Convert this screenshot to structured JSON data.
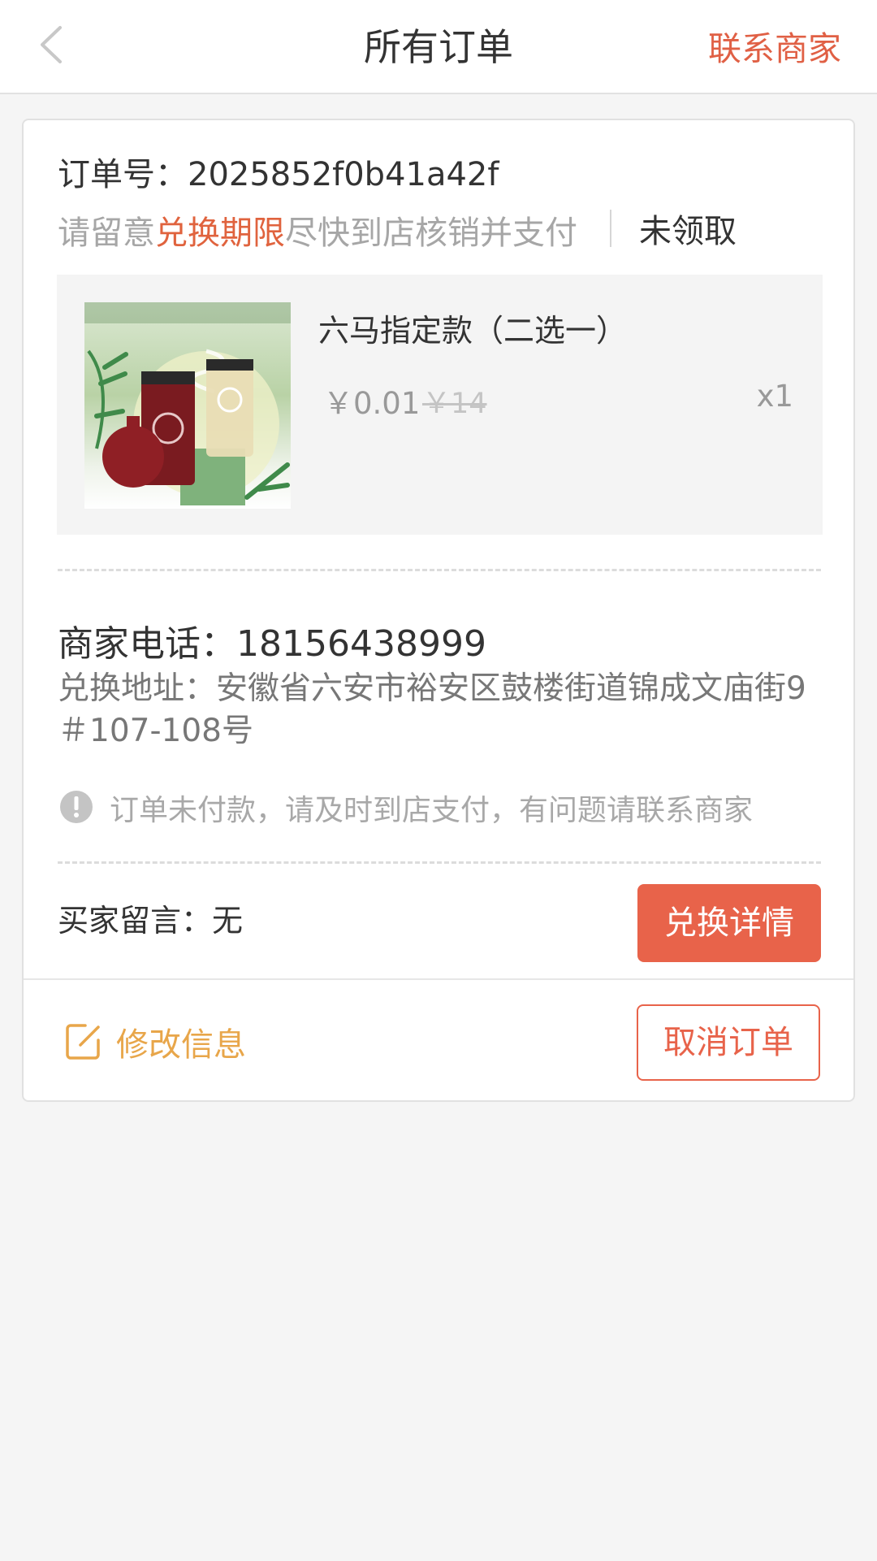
{
  "header": {
    "title": "所有订单",
    "contact_label": "联系商家"
  },
  "order": {
    "order_no": "订单号：2025852f0b41a42f",
    "notice_prefix": "请留意",
    "notice_highlight": "兑换期限",
    "notice_suffix": "尽快到店核销并支付",
    "status": "未领取"
  },
  "product": {
    "name": "六马指定款（二选一）",
    "price": "￥0.01",
    "original_price": "￥14",
    "quantity": "x1",
    "image_icon": "milk-tea-product-image"
  },
  "merchant": {
    "phone": "商家电话：18156438999",
    "address": "兑换地址：安徽省六安市裕安区鼓楼街道锦成文庙街9＃107-108号"
  },
  "warning": {
    "icon": "exclamation-circle-icon",
    "text": "订单未付款，请及时到店支付，有问题请联系商家"
  },
  "buyer": {
    "message": "买家留言：无"
  },
  "actions": {
    "detail_label": "兑换详情",
    "edit_label": "修改信息",
    "cancel_label": "取消订单"
  },
  "colors": {
    "accent": "#e8634a",
    "edit": "#e8a64a",
    "background": "#f5f5f5"
  }
}
